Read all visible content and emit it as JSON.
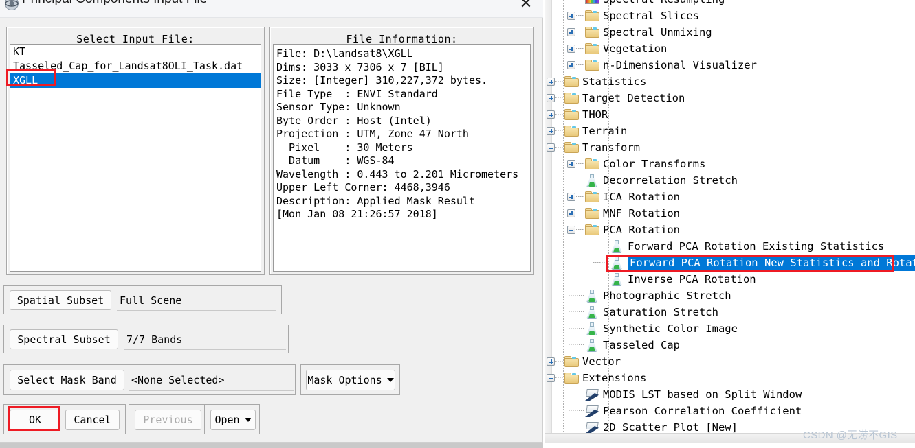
{
  "window": {
    "title": "Principal Components Input File",
    "icon": "envi-app-icon",
    "close_label": "✕"
  },
  "select_input_file": {
    "title": "Select Input File:",
    "items": [
      {
        "label": "KT",
        "selected": false
      },
      {
        "label": "Tasseled_Cap_for_Landsat8OLI_Task.dat",
        "selected": false
      },
      {
        "label": "XGLL",
        "selected": true
      }
    ]
  },
  "file_information": {
    "title": "File Information:",
    "lines": [
      "File: D:\\landsat8\\XGLL",
      "Dims: 3033 x 7306 x 7 [BIL]",
      "Size: [Integer] 310,227,372 bytes.",
      "File Type  : ENVI Standard",
      "Sensor Type: Unknown",
      "Byte Order : Host (Intel)",
      "Projection : UTM, Zone 47 North",
      "  Pixel    : 30 Meters",
      "  Datum    : WGS-84",
      "Wavelength : 0.443 to 2.201 Micrometers",
      "Upper Left Corner: 4468,3946",
      "Description: Applied Mask Result",
      "[Mon Jan 08 21:26:57 2018]"
    ]
  },
  "subset_rows": {
    "spatial": {
      "button": "Spatial Subset",
      "value": "Full Scene"
    },
    "spectral": {
      "button": "Spectral Subset",
      "value": "7/7 Bands"
    },
    "mask": {
      "button": "Select Mask Band",
      "value": "<None Selected>",
      "options_button": "Mask Options"
    }
  },
  "actions": {
    "ok": "OK",
    "cancel": "Cancel",
    "previous": "Previous",
    "open": "Open"
  },
  "toolbox_tree": {
    "rows": [
      {
        "label": "Spectral Resampling",
        "icon": "rainbow-icon",
        "indent": 2,
        "expander": "none",
        "clipped": true
      },
      {
        "label": "Spectral Slices",
        "icon": "folder-icon",
        "indent": 2,
        "expander": "plus"
      },
      {
        "label": "Spectral Unmixing",
        "icon": "folder-icon",
        "indent": 2,
        "expander": "plus"
      },
      {
        "label": "Vegetation",
        "icon": "folder-icon",
        "indent": 2,
        "expander": "plus"
      },
      {
        "label": "n-Dimensional Visualizer",
        "icon": "folder-icon",
        "indent": 2,
        "expander": "plus"
      },
      {
        "label": "Statistics",
        "icon": "folder-icon",
        "indent": 1,
        "expander": "plus"
      },
      {
        "label": "Target Detection",
        "icon": "folder-icon",
        "indent": 1,
        "expander": "plus"
      },
      {
        "label": "THOR",
        "icon": "folder-icon",
        "indent": 1,
        "expander": "plus"
      },
      {
        "label": "Terrain",
        "icon": "folder-icon",
        "indent": 1,
        "expander": "plus"
      },
      {
        "label": "Transform",
        "icon": "folder-open-icon",
        "indent": 1,
        "expander": "minus"
      },
      {
        "label": "Color Transforms",
        "icon": "folder-icon",
        "indent": 2,
        "expander": "plus"
      },
      {
        "label": "Decorrelation Stretch",
        "icon": "flask-icon",
        "indent": 2,
        "expander": "none"
      },
      {
        "label": "ICA Rotation",
        "icon": "folder-icon",
        "indent": 2,
        "expander": "plus"
      },
      {
        "label": "MNF Rotation",
        "icon": "folder-icon",
        "indent": 2,
        "expander": "plus"
      },
      {
        "label": "PCA Rotation",
        "icon": "folder-open-icon",
        "indent": 2,
        "expander": "minus"
      },
      {
        "label": "Forward PCA Rotation Existing Statistics",
        "icon": "flask-icon",
        "indent": 3,
        "expander": "none"
      },
      {
        "label": "Forward PCA Rotation New Statistics and Rotate",
        "icon": "flask-icon",
        "indent": 3,
        "expander": "none",
        "selected": true,
        "highlighted": true
      },
      {
        "label": "Inverse PCA Rotation",
        "icon": "flask-icon",
        "indent": 3,
        "expander": "none"
      },
      {
        "label": "Photographic Stretch",
        "icon": "flask-icon",
        "indent": 2,
        "expander": "none"
      },
      {
        "label": "Saturation Stretch",
        "icon": "flask-icon",
        "indent": 2,
        "expander": "none"
      },
      {
        "label": "Synthetic Color Image",
        "icon": "flask-icon",
        "indent": 2,
        "expander": "none"
      },
      {
        "label": "Tasseled Cap",
        "icon": "flask-icon",
        "indent": 2,
        "expander": "none"
      },
      {
        "label": "Vector",
        "icon": "folder-icon",
        "indent": 1,
        "expander": "plus"
      },
      {
        "label": "Extensions",
        "icon": "folder-open-icon",
        "indent": 1,
        "expander": "minus"
      },
      {
        "label": "MODIS LST based on Split Window",
        "icon": "extension-icon",
        "indent": 2,
        "expander": "none"
      },
      {
        "label": "Pearson Correlation Coefficient",
        "icon": "extension-icon",
        "indent": 2,
        "expander": "none"
      },
      {
        "label": "2D Scatter Plot [New]",
        "icon": "extension-icon",
        "indent": 2,
        "expander": "none"
      }
    ]
  },
  "watermark": {
    "text": "CSDN @无涝不GIS"
  },
  "colors": {
    "selection_blue": "#0078d7",
    "annotation_red": "#ee1b24",
    "dialog_bg": "#f0f0f0"
  }
}
